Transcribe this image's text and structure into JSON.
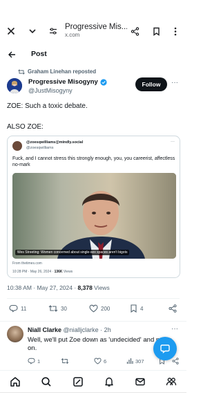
{
  "browser": {
    "page_title": "Progressive Mis...",
    "host": "x.com"
  },
  "header": {
    "title": "Post"
  },
  "post": {
    "repost_text": "Graham Linehan reposted",
    "author_name": "Progressive Misogyny",
    "author_handle": "@JustMisogyny",
    "follow_label": "Follow",
    "text_line1": "ZOE: Such a toxic debate.",
    "text_line2": "ALSO ZOE:",
    "quote": {
      "author_name": "@zoesqwilliams@mindly.social",
      "author_handle": "@zoesqwilliams",
      "text": "Fuck, and I cannot stress this strongly enough, you, you careerist, affectless no-mark",
      "image_caption": "Wes Streeting: Women concerned about single-sex spaces aren't bigots",
      "from": "From thetimes.com",
      "meta_time": "10:28 PM · May 26, 2024 · ",
      "meta_views_count": "136K",
      "meta_views_label": " Views"
    },
    "timestamp": "10:38 AM · May 27, 2024 · ",
    "views_count": "8,378",
    "views_label": " Views",
    "actions": {
      "replies": "11",
      "reposts": "30",
      "likes": "200",
      "bookmarks": "4"
    }
  },
  "reply": {
    "author_name": "Niall Clarke",
    "author_meta": " @nialljclarke · 2h",
    "text": "Well, we'll put Zoe down as 'undecided' and move on.",
    "actions": {
      "replies": "1",
      "reposts": "",
      "likes": "6",
      "views": "307"
    }
  },
  "colors": {
    "accent": "#1d9bf0",
    "text": "#0f1419",
    "muted": "#536471",
    "follow_bg": "#0f1419"
  }
}
